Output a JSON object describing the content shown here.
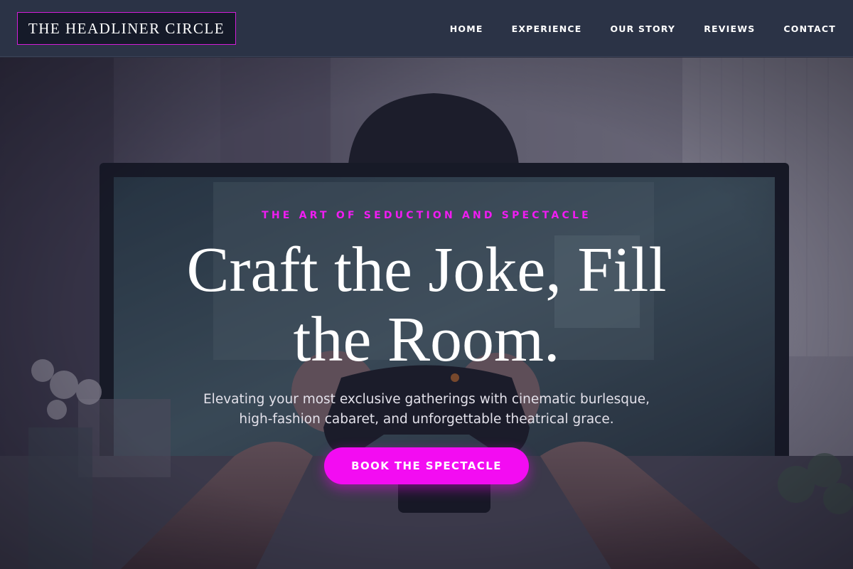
{
  "header": {
    "logo": "THE HEADLINER CIRCLE",
    "nav": [
      {
        "label": "HOME"
      },
      {
        "label": "EXPERIENCE"
      },
      {
        "label": "OUR STORY"
      },
      {
        "label": "REVIEWS"
      },
      {
        "label": "CONTACT"
      }
    ]
  },
  "hero": {
    "kicker": "THE ART OF SEDUCTION AND SPECTACLE",
    "headline": "Craft the Joke, Fill the Room.",
    "subtitle": "Elevating your most exclusive gatherings with cinematic burlesque, high-fashion cabaret, and unforgettable theatrical grace.",
    "cta_label": "BOOK THE SPECTACLE"
  },
  "colors": {
    "accent": "#f30cf2",
    "header_bg": "#2b3346",
    "logo_border": "#d21ed8"
  }
}
